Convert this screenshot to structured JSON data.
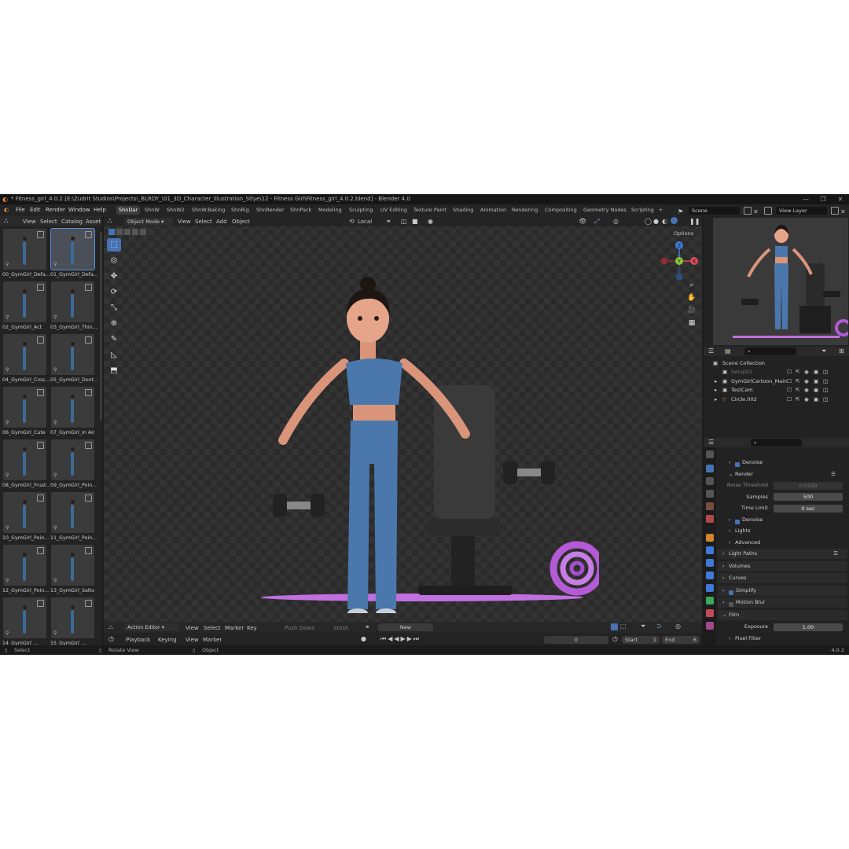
{
  "window": {
    "title": "* Fitness_girl_4.0.2 [E:\\Zudrit Studios\\Projects\\_BLRDY_\\01_3D_Character_Illustration_Stlye\\12 - Fitness Girl\\Fitness_girl_4.0.2.blend] - Blender 4.0",
    "controls": [
      "—",
      "❐",
      "✕"
    ]
  },
  "menubar": {
    "menus": [
      "File",
      "Edit",
      "Render",
      "Window",
      "Help"
    ],
    "workspaces": [
      "ShnDar",
      "ShnW",
      "ShnW2",
      "ShnW.Baking",
      "ShnRig",
      "ShnRender",
      "ShnPack",
      "Modeling",
      "Sculpting",
      "UV Editing",
      "Texture Paint",
      "Shading",
      "Animation",
      "Rendering",
      "Compositing",
      "Geometry Nodes",
      "Scripting"
    ],
    "active_workspace": "ShnDar",
    "add_tab": "+",
    "scene": "Scene",
    "view_layer": "View Layer"
  },
  "asset_browser": {
    "menus": [
      "View",
      "Select",
      "Catalog",
      "Asset"
    ],
    "items": [
      "00_GymGirl_Defa...",
      "01_GymGirl_Defa...",
      "02_GymGirl_Act",
      "03_GymGirl_Thin...",
      "04_GymGirl_Cros...",
      "05_GymGirl_Dont...",
      "06_GymGirl_Cute",
      "07_GymGirl_In Air",
      "08_GymGirl_Frust...",
      "09_GymGirl_Poin...",
      "10_GymGirl_Poin...",
      "11_GymGirl_Poin...",
      "12_GymGirl_Poin...",
      "13_GymGirl_Salto",
      "14_GymGirl_...",
      "15_GymGirl_..."
    ],
    "selected_index": 1
  },
  "viewport": {
    "mode": "Object Mode",
    "menus": [
      "View",
      "Select",
      "Add",
      "Object"
    ],
    "transform": "Local",
    "options": "Options",
    "tools": [
      "select-box",
      "cursor",
      "move",
      "rotate",
      "scale",
      "transform",
      "annotate",
      "measure",
      "add-cube"
    ],
    "gizmo": {
      "x": "X",
      "y": "Y",
      "z": "Z"
    }
  },
  "timeline": {
    "editor": "Action Editor",
    "menus": [
      "View",
      "Select",
      "Marker",
      "Key"
    ],
    "push_down": "Push Down",
    "stash": "Stash",
    "new": "New",
    "playback_menus": [
      "Playback",
      "Keying",
      "View",
      "Marker"
    ],
    "current_frame": "0",
    "start_label": "Start",
    "start": "1",
    "end_label": "End",
    "end": "6"
  },
  "outliner": {
    "root": "Scene Collection",
    "rows": [
      "Setup02",
      "GymGirlCartoon_Main",
      "TestCam",
      "Circle.002"
    ]
  },
  "properties": {
    "rows": [
      {
        "label": "Denoise",
        "type": "check-sub",
        "checked": true
      },
      {
        "label": "Render",
        "type": "sub-open"
      },
      {
        "label": "Noise Threshold",
        "type": "value",
        "value": "0.0100",
        "dim": true
      },
      {
        "label": "Samples",
        "type": "value",
        "value": "500"
      },
      {
        "label": "Time Limit",
        "type": "value",
        "value": "0 sec"
      },
      {
        "label": "Denoise",
        "type": "check-sub",
        "checked": true
      },
      {
        "label": "Lights",
        "type": "sub"
      },
      {
        "label": "Advanced",
        "type": "sub"
      },
      {
        "label": "Light Paths",
        "type": "panel"
      },
      {
        "label": "Volumes",
        "type": "panel"
      },
      {
        "label": "Curves",
        "type": "panel"
      },
      {
        "label": "Simplify",
        "type": "panel-check",
        "checked": true
      },
      {
        "label": "Motion Blur",
        "type": "panel-check",
        "checked": false
      },
      {
        "label": "Film",
        "type": "panel-open"
      },
      {
        "label": "Exposure",
        "type": "value",
        "value": "1.00"
      },
      {
        "label": "Pixel Filter",
        "type": "sub"
      }
    ]
  },
  "statusbar": {
    "select": "Select",
    "rotate": "Rotate View",
    "object": "Object",
    "version": "4.0.2"
  },
  "colors": {
    "accent": "#4772b3",
    "x_axis": "#d44b5a",
    "y_axis": "#8bc33a",
    "z_axis": "#3f7ad8",
    "mat": "#b45ad6",
    "outfit": "#4a78ad"
  }
}
